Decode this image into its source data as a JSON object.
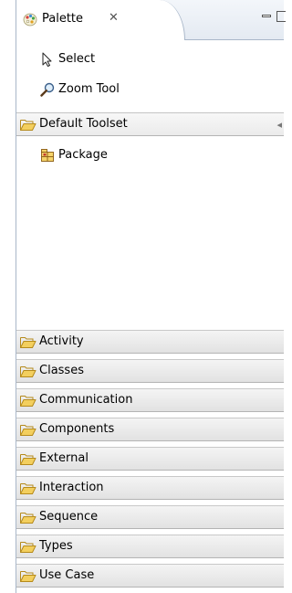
{
  "tab": {
    "title": "Palette",
    "close_glyph": "✕",
    "icon": "palette-icon"
  },
  "tools": [
    {
      "label": "Select",
      "icon": "arrow-pointer-icon"
    },
    {
      "label": "Zoom Tool",
      "icon": "magnifier-icon"
    }
  ],
  "default_toolset": {
    "label": "Default Toolset",
    "items": [
      {
        "label": "Package",
        "icon": "package-icon"
      }
    ]
  },
  "drawers": [
    {
      "label": "Activity"
    },
    {
      "label": "Classes"
    },
    {
      "label": "Communication"
    },
    {
      "label": "Components"
    },
    {
      "label": "External"
    },
    {
      "label": "Interaction"
    },
    {
      "label": "Sequence"
    },
    {
      "label": "Types"
    },
    {
      "label": "Use Case"
    }
  ],
  "colors": {
    "folder_fill": "#f3cf5e",
    "folder_stroke": "#b58a1b",
    "border": "#a9b7c9"
  }
}
